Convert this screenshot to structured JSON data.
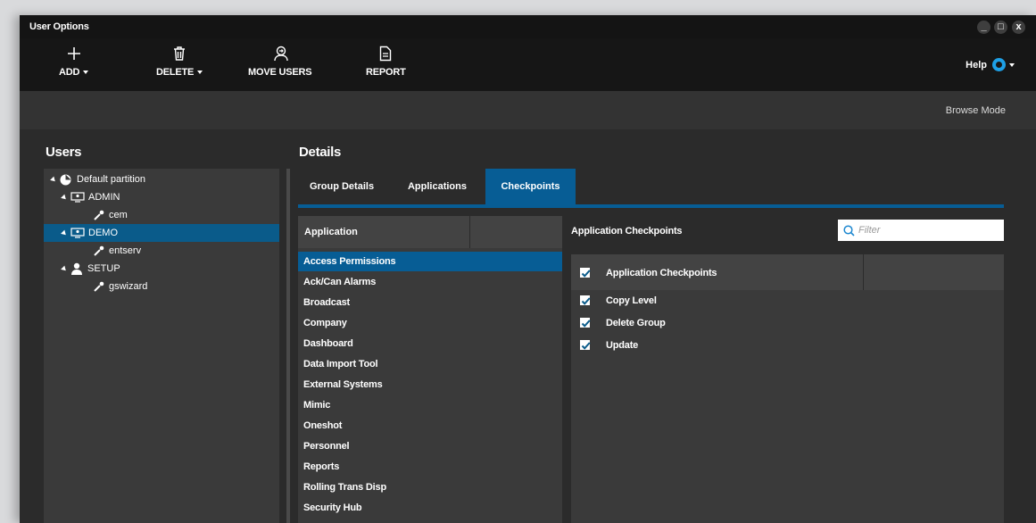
{
  "window": {
    "title": "User Options",
    "controls": [
      "_",
      "□",
      "x"
    ]
  },
  "toolbar": {
    "add_label": "ADD",
    "delete_label": "DELETE",
    "move_users_label": "MOVE USERS",
    "report_label": "REPORT",
    "help_label": "Help",
    "icons": {
      "add": "plus-icon",
      "delete": "trash-icon",
      "move_users": "user-move-icon",
      "report": "report-document-icon",
      "help": "help-ring-icon"
    }
  },
  "mode": {
    "label": "Browse Mode"
  },
  "users": {
    "title": "Users",
    "tree": [
      {
        "label": "Default partition",
        "level": 0,
        "icon": "partition-icon",
        "expanded": true,
        "selected": false
      },
      {
        "label": "ADMIN",
        "level": 1,
        "icon": "group-monitor-icon",
        "expanded": true,
        "selected": false
      },
      {
        "label": "cem",
        "level": 2,
        "icon": "user-key-icon",
        "selected": false
      },
      {
        "label": "DEMO",
        "level": 1,
        "icon": "group-monitor-icon",
        "expanded": true,
        "selected": true
      },
      {
        "label": "entserv",
        "level": 2,
        "icon": "user-key-icon",
        "selected": false
      },
      {
        "label": "SETUP",
        "level": 1,
        "icon": "person-icon",
        "expanded": true,
        "selected": false
      },
      {
        "label": "gswizard",
        "level": 2,
        "icon": "user-key-icon",
        "selected": false
      }
    ]
  },
  "details": {
    "title": "Details",
    "tabs": [
      {
        "label": "Group Details",
        "active": false
      },
      {
        "label": "Applications",
        "active": false
      },
      {
        "label": "Checkpoints",
        "active": true
      }
    ],
    "app_table": {
      "header": "Application",
      "rows": [
        "Access Permissions",
        "Ack/Can Alarms",
        "Broadcast",
        "Company",
        "Dashboard",
        "Data Import Tool",
        "External Systems",
        "Mimic",
        "Oneshot",
        "Personnel",
        "Reports",
        "Rolling Trans Disp",
        "Security Hub"
      ],
      "selected_index": 0
    },
    "checkpoints": {
      "title": "Application Checkpoints",
      "filter_placeholder": "Filter",
      "header": "Application Checkpoints",
      "header_checked": true,
      "rows": [
        {
          "label": "Copy Level",
          "checked": true
        },
        {
          "label": "Delete Group",
          "checked": true
        },
        {
          "label": "Update",
          "checked": true
        }
      ]
    }
  },
  "colors": {
    "accent": "#075d95",
    "selection": "#0a5b8a",
    "help_ring": "#1ea0e6",
    "panel": "#3a3a3a",
    "background": "#2b2b2b"
  }
}
